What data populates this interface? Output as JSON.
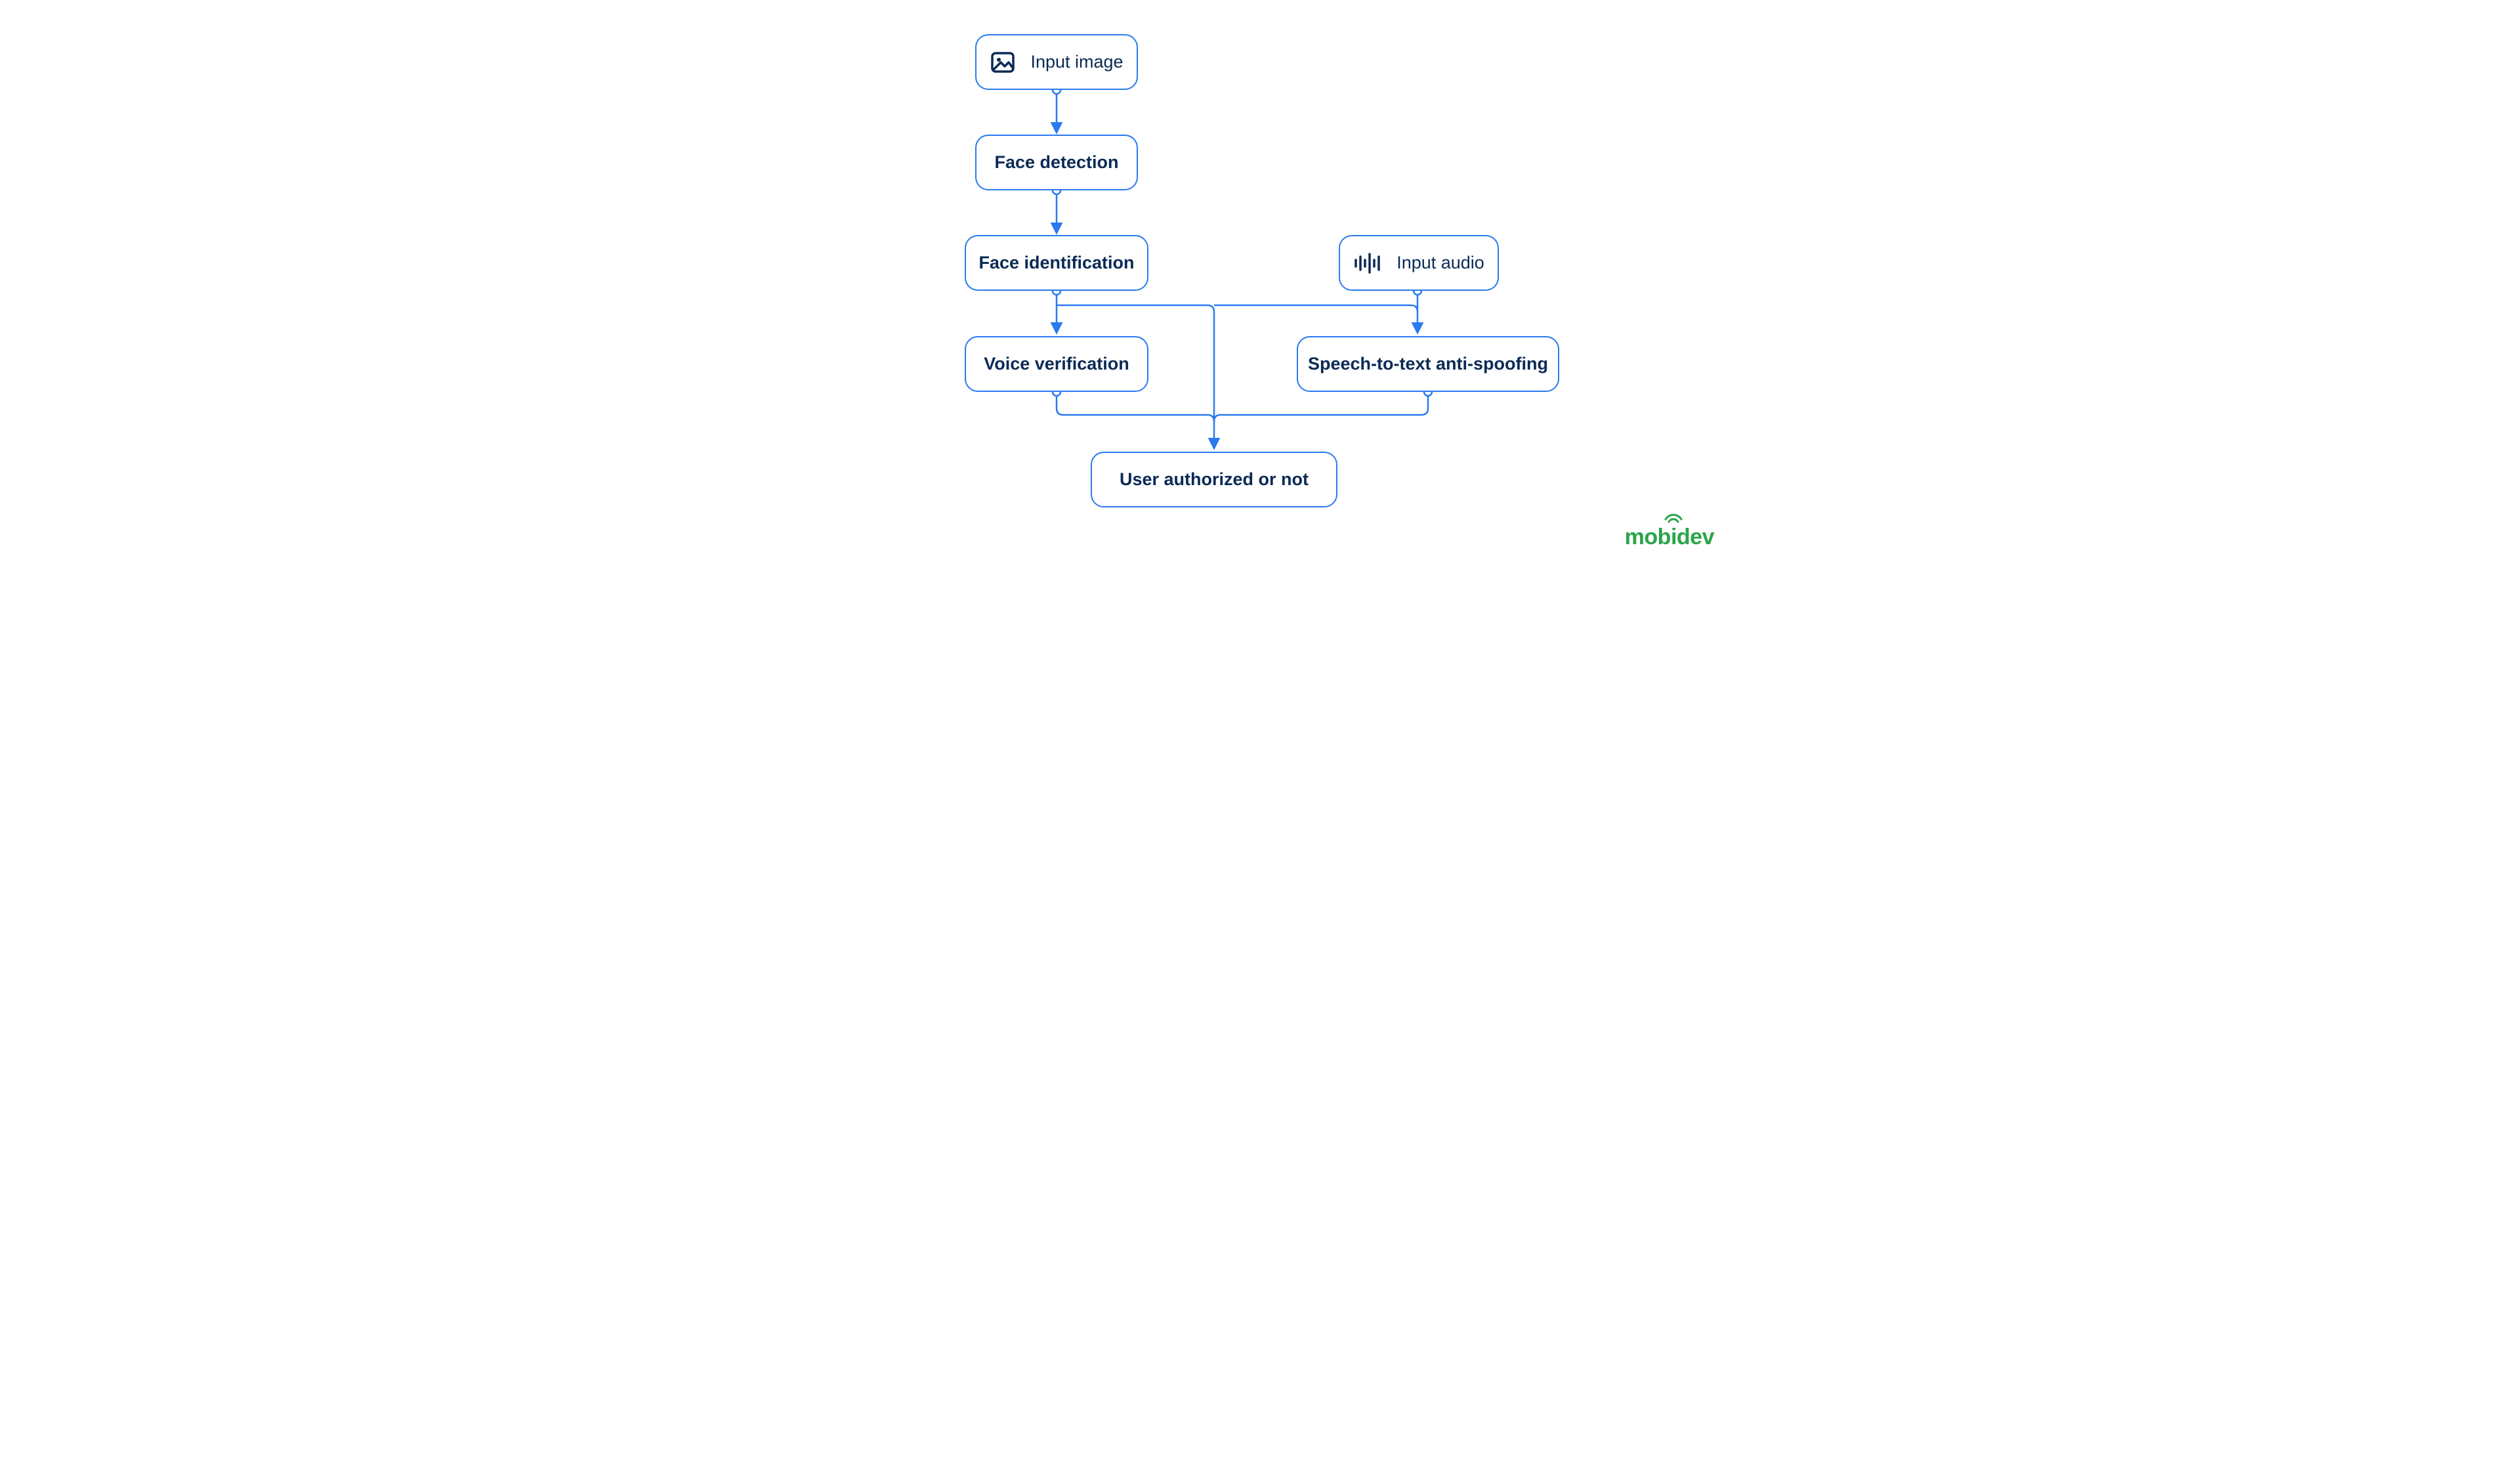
{
  "colors": {
    "stroke": "#2a7af0",
    "text": "#0b2a55",
    "logo": "#2aa54a"
  },
  "nodes": {
    "input_image": {
      "label": "Input image",
      "icon": "image-icon"
    },
    "face_detection": {
      "label": "Face detection"
    },
    "face_identification": {
      "label": "Face identification"
    },
    "input_audio": {
      "label": "Input audio",
      "icon": "audio-waveform-icon"
    },
    "voice_verification": {
      "label": "Voice verification"
    },
    "speech_to_text": {
      "label": "Speech-to-text anti-spoofing"
    },
    "user_authorized": {
      "label": "User authorized or not"
    }
  },
  "logo": {
    "text_prefix": "mob",
    "text_mid": "i",
    "text_suffix": "dev"
  }
}
